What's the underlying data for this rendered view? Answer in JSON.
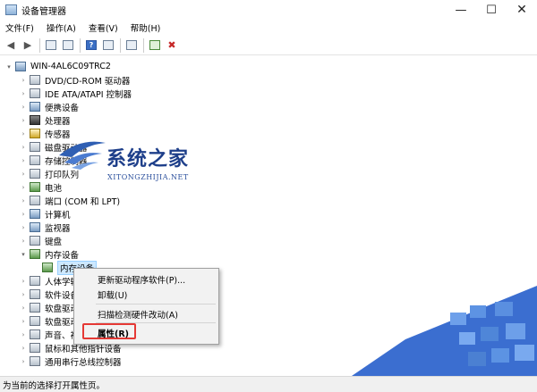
{
  "window": {
    "title": "设备管理器"
  },
  "title_controls": {
    "minimize": "—",
    "maximize": "☐",
    "close": "✕"
  },
  "menu": [
    "文件(F)",
    "操作(A)",
    "查看(V)",
    "帮助(H)"
  ],
  "toolbar_icons": [
    "back-arrow-icon",
    "forward-arrow-icon",
    "properties-icon",
    "show-icon",
    "help-icon",
    "view-icon",
    "scan-icon",
    "update-driver-icon",
    "uninstall-icon"
  ],
  "tree": {
    "root": "WIN-4AL6C09TRC2",
    "items": [
      {
        "label": "DVD/CD-ROM 驱动器",
        "expanded": false
      },
      {
        "label": "IDE ATA/ATAPI 控制器",
        "expanded": false
      },
      {
        "label": "便携设备",
        "expanded": false
      },
      {
        "label": "处理器",
        "expanded": false
      },
      {
        "label": "传感器",
        "expanded": false
      },
      {
        "label": "磁盘驱动器",
        "expanded": false
      },
      {
        "label": "存储控制器",
        "expanded": false
      },
      {
        "label": "打印队列",
        "expanded": false
      },
      {
        "label": "电池",
        "expanded": false
      },
      {
        "label": "端口 (COM 和 LPT)",
        "expanded": false
      },
      {
        "label": "计算机",
        "expanded": false
      },
      {
        "label": "监视器",
        "expanded": false
      },
      {
        "label": "键盘",
        "expanded": false
      },
      {
        "label": "内存设备",
        "expanded": true
      },
      {
        "label": "内存设备",
        "child": true,
        "selected": true
      },
      {
        "label": "人体学输入设备",
        "expanded": false
      },
      {
        "label": "软件设备",
        "expanded": false
      },
      {
        "label": "软盘驱动器",
        "expanded": false
      },
      {
        "label": "软盘驱动器控制器",
        "expanded": false
      },
      {
        "label": "声音、视频和游戏控制器",
        "expanded": false
      },
      {
        "label": "鼠标和其他指针设备",
        "expanded": false
      },
      {
        "label": "通用串行总线控制器",
        "expanded": false
      }
    ]
  },
  "context_menu": {
    "items": [
      "更新驱动程序软件(P)...",
      "卸载(U)",
      "扫描检测硬件改动(A)",
      "属性(R)"
    ],
    "highlighted": "属性(R)",
    "highlight_color": "#e53935"
  },
  "status": "为当前的选择打开属性页。",
  "watermark": {
    "title": "系统之家",
    "subtitle": "XITONGZHIJIA.NET"
  },
  "colors": {
    "selection": "#cde8ff",
    "watermark_blue": "#1e3f8a"
  }
}
